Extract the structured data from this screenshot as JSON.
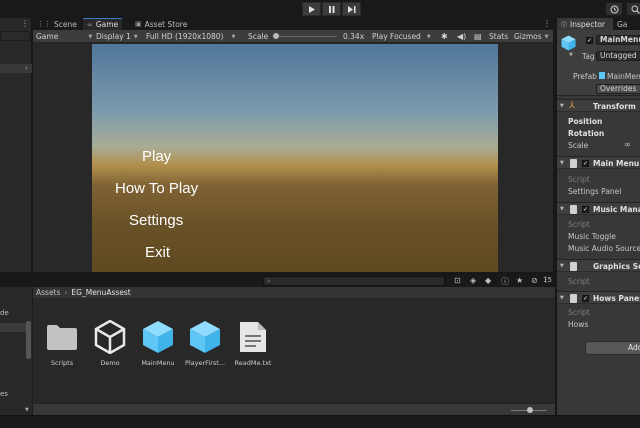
{
  "toolbar": {
    "play_icon": "play-icon",
    "pause_icon": "pause-icon",
    "step_icon": "step-icon",
    "history_icon": "history-icon",
    "search_icon": "search-icon"
  },
  "tabs": [
    {
      "label": "Scene",
      "icon": "scene-grid-icon"
    },
    {
      "label": "Game",
      "icon": "game-controller-icon"
    },
    {
      "label": "Asset Store",
      "icon": "asset-store-icon"
    }
  ],
  "game_toolbar": {
    "mode": "Game",
    "display": "Display 1",
    "resolution": "Full HD (1920x1080)",
    "scale_label": "Scale",
    "scale_value": "0.34x",
    "play_mode": "Play Focused",
    "stats": "Stats",
    "gizmos": "Gizmos"
  },
  "game_menu": [
    "Play",
    "How To Play",
    "Settings",
    "Exit"
  ],
  "project": {
    "breadcrumb": [
      "Assets",
      "EG_MenuAssest"
    ],
    "hidden_count": "15",
    "left_labels": [
      "de",
      "es"
    ],
    "assets": [
      {
        "label": "Scripts",
        "icon": "folder-icon"
      },
      {
        "label": "Demo",
        "icon": "unity-scene-icon"
      },
      {
        "label": "MainMenu",
        "icon": "prefab-cube-icon"
      },
      {
        "label": "PlayerFirst...",
        "icon": "prefab-cube-icon"
      },
      {
        "label": "ReadMe.txt",
        "icon": "text-document-icon"
      }
    ]
  },
  "inspector": {
    "tabs": [
      "Inspector",
      "Ga"
    ],
    "object_name": "MainMenu",
    "tag_label": "Tag",
    "tag_value": "Untagged",
    "prefab_label": "Prefab",
    "prefab_value": "MainMen",
    "overrides": "Overrides",
    "transform": {
      "title": "Transform",
      "fields": [
        "Position",
        "Rotation",
        "Scale"
      ]
    },
    "components": [
      {
        "title": "Main Menu (S",
        "fields": [
          "Script",
          "Settings Panel"
        ]
      },
      {
        "title": "Music Manag",
        "fields": [
          "Script",
          "Music Toggle",
          "Music Audio Source"
        ]
      },
      {
        "title": "Graphics Set",
        "fields": [
          "Script"
        ]
      },
      {
        "title": "Hows Panel (",
        "fields": [
          "Script",
          "Hows"
        ]
      }
    ],
    "add_button": "Add"
  }
}
